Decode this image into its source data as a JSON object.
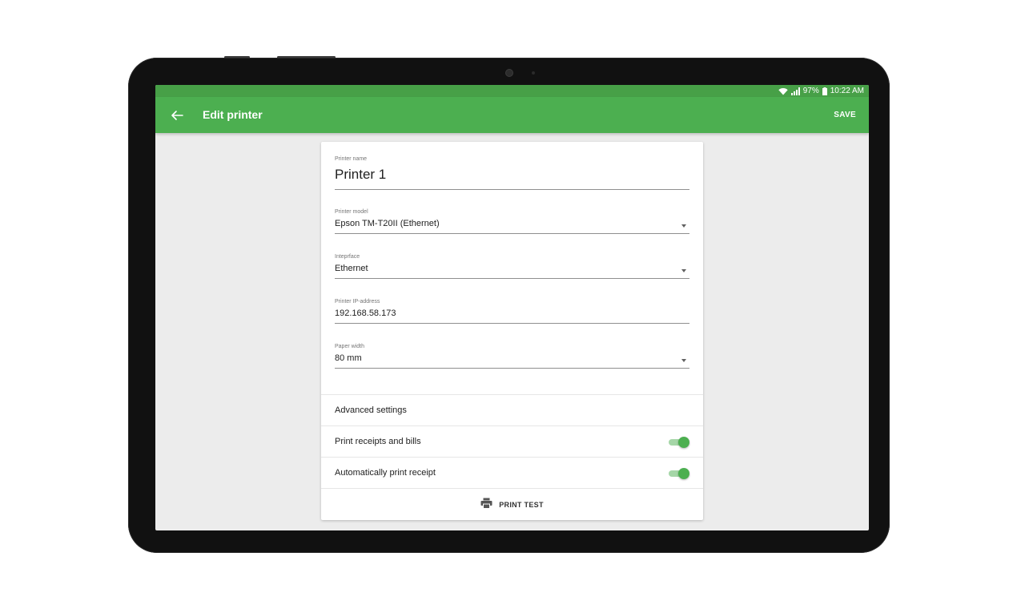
{
  "status_bar": {
    "battery_percent": "97%",
    "time": "10:22 AM",
    "icons": [
      "wifi-icon",
      "signal-icon",
      "battery-icon"
    ]
  },
  "app_bar": {
    "back_icon": "arrow-back-icon",
    "title": "Edit printer",
    "save_label": "SAVE"
  },
  "form": {
    "printer_name": {
      "label": "Printer name",
      "value": "Printer 1"
    },
    "printer_model": {
      "label": "Printer model",
      "value": "Epson TM-T20II (Ethernet)"
    },
    "interface": {
      "label": "Inteprface",
      "value": "Ethernet"
    },
    "ip_address": {
      "label": "Printer IP-address",
      "value": "192.168.58.173"
    },
    "paper_width": {
      "label": "Paper width",
      "value": "80 mm"
    }
  },
  "settings": {
    "advanced_label": "Advanced settings",
    "print_receipts": {
      "label": "Print receipts and bills",
      "enabled": true
    },
    "auto_print": {
      "label": "Automatically print receipt",
      "enabled": true
    }
  },
  "print_test": {
    "icon": "printer-icon",
    "label": "PRINT TEST"
  },
  "colors": {
    "accent": "#4caf50",
    "status_bar": "#47a047",
    "switch_track": "#a5d6a7",
    "background": "#ececec"
  }
}
